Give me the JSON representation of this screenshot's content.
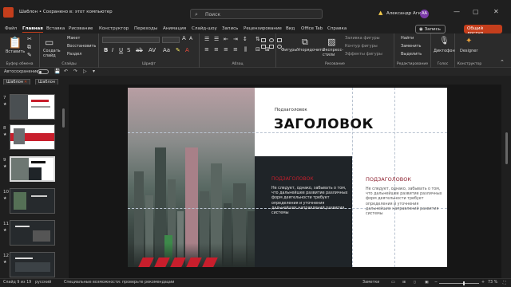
{
  "titlebar": {
    "title": "Шаблон • Сохранено в: этот компьютер",
    "search_placeholder": "Поиск",
    "user_name": "Александр Агин",
    "avatar_initials": "АА"
  },
  "tabs": [
    "Файл",
    "Главная",
    "Вставка",
    "Рисование",
    "Конструктор",
    "Переходы",
    "Анимация",
    "Слайд-шоу",
    "Запись",
    "Рецензирование",
    "Вид",
    "Office Tab",
    "Справка"
  ],
  "active_tab": "Главная",
  "actions": {
    "record": "Запись",
    "share": "Общий доступ"
  },
  "ribbon": {
    "clipboard": {
      "paste": "Вставить",
      "label": "Буфер обмена"
    },
    "slides": {
      "new_slide": "Создать слайд",
      "layout": "Макет",
      "reset": "Восстановить",
      "sections": "Раздел",
      "label": "Слайды"
    },
    "font": {
      "label": "Шрифт"
    },
    "paragraph": {
      "label": "Абзац"
    },
    "drawing": {
      "shapes": "Фигуры",
      "arrange": "Упорядочить",
      "styles": "Экспресс-стили",
      "fill": "Заливка фигуры",
      "outline": "Контур фигуры",
      "effects": "Эффекты фигуры",
      "label": "Рисование"
    },
    "editing": {
      "find": "Найти",
      "replace": "Заменить",
      "select": "Выделить",
      "label": "Редактирование"
    },
    "voice": {
      "dictate": "Диктофон",
      "label": "Голос"
    },
    "designer": {
      "button": "Designer",
      "label": "Конструктор"
    }
  },
  "quick_access": {
    "autosave": "Автосохранение"
  },
  "doc_tabs": [
    "Шаблон",
    "Шаблон"
  ],
  "thumbnails": [
    {
      "num": "7",
      "star": "★"
    },
    {
      "num": "8",
      "star": "★"
    },
    {
      "num": "9",
      "star": "★"
    },
    {
      "num": "10",
      "star": "★"
    },
    {
      "num": "11",
      "star": "★"
    },
    {
      "num": "12",
      "star": "★"
    }
  ],
  "slide": {
    "subtitle_top": "Подзаголовок",
    "title": "ЗАГОЛОВОК",
    "heading_left": "ПОДЗАГОЛОВОК",
    "text_left": "Не следует, однако, забывать о том, что дальнейшее развитие различных форм деятельности требует определения и уточнения дальнейших направлений развития системы",
    "heading_right": "ПОДЗАГОЛОВОК",
    "text_right": "Не следует, однако, забывать о том, что дальнейшее развитие различных форм деятельности требует определения и уточнения дальнейших направлений развития системы",
    "accent_color": "#c81e2c",
    "dark_panel_color": "#1f2428"
  },
  "statusbar": {
    "slide_info": "Слайд 9 из 19",
    "language": "русский",
    "accessibility": "Специальные возможности: проверьте рекомендации",
    "notes": "Заметки",
    "zoom": "73 %"
  }
}
